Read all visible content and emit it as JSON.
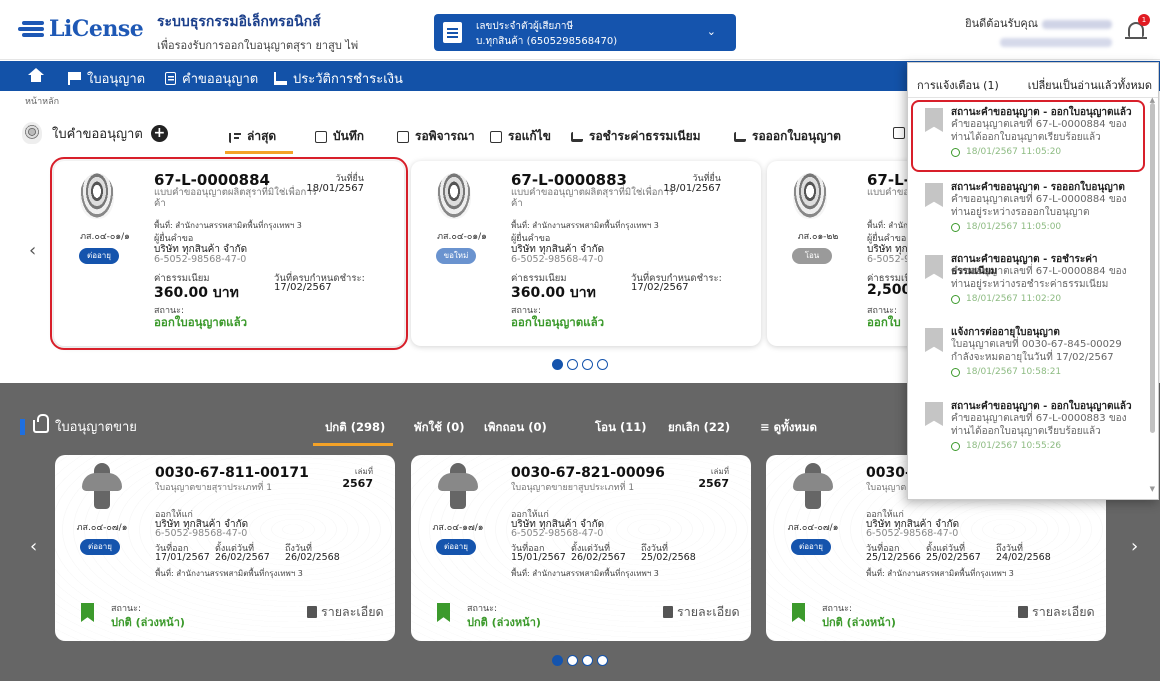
{
  "header": {
    "logo_text": "LiCense",
    "system_title": "ระบบธุรกรรมอิเล็กทรอนิกส์",
    "system_subtitle": "เพื่อรองรับการออกใบอนุญาตสุรา ยาสูบ ไพ่",
    "licensee_label": "เลขประจำตัวผู้เสียภาษี",
    "licensee_value": "บ.ทุกสินค้า (6505298568470)",
    "welcome_text": "ยินดีต้อนรับคุณ",
    "notification_count": "1"
  },
  "nav": {
    "items": [
      "ใบอนุญาต",
      "คำขออนุญาต",
      "ประวัติการชำระเงิน"
    ]
  },
  "breadcrumb": "หน้าหลัก",
  "applications": {
    "title": "ใบคำขออนุญาต",
    "tabs": [
      "ล่าสุด",
      "บันทึก",
      "รอพิจารณา",
      "รอแก้ไข",
      "รอชำระค่าธรรมเนียม",
      "รอออกใบอนุญาต"
    ],
    "cards": [
      {
        "code": "ภส.๐๔-๐๑/๑",
        "badge": "ต่ออายุ",
        "number": "67-L-0000884",
        "type": "แบบคำขออนุญาตผลิตสุราที่มิใช่เพื่อการค้า",
        "date_label": "วันที่ยื่น",
        "date_value": "18/01/2567",
        "area": "พื้นที่: สำนักงานสรรพสามิตพื้นที่กรุงเทพฯ 3",
        "applicant_label": "ผู้ยื่นคำขอ",
        "company": "บริษัท ทุกสินค้า จำกัด",
        "tax_id": "6-5052-98568-47-0",
        "fee_label": "ค่าธรรมเนียม",
        "fee_value": "360.00 บาท",
        "due_label": "วันที่ครบกำหนดชำระ:",
        "due_value": "17/02/2567",
        "status_label": "สถานะ:",
        "status_value": "ออกใบอนุญาตแล้ว"
      },
      {
        "code": "ภส.๐๔-๐๑/๑",
        "badge": "ขอใหม่",
        "number": "67-L-0000883",
        "type": "แบบคำขออนุญาตผลิตสุราที่มิใช่เพื่อการค้า",
        "date_label": "วันที่ยื่น",
        "date_value": "18/01/2567",
        "area": "พื้นที่: สำนักงานสรรพสามิตพื้นที่กรุงเทพฯ 3",
        "applicant_label": "ผู้ยื่นคำขอ",
        "company": "บริษัท ทุกสินค้า จำกัด",
        "tax_id": "6-5052-98568-47-0",
        "fee_label": "ค่าธรรมเนียม",
        "fee_value": "360.00 บาท",
        "due_label": "วันที่ครบกำหนดชำระ:",
        "due_value": "17/02/2567",
        "status_label": "สถานะ:",
        "status_value": "ออกใบอนุญาตแล้ว"
      },
      {
        "code": "ภส.๐๑-๒๒",
        "badge": "โอน",
        "number": "67-L-0",
        "type": "แบบคำขอ",
        "date_label": "",
        "date_value": "",
        "area": "พื้นที่: สำนัก",
        "applicant_label": "ผู้ยื่นคำขอ",
        "company": "บริษัท ทุกส",
        "tax_id": "6-5052-9",
        "fee_label": "ค่าธรรมเนี",
        "fee_value": "2,500.0",
        "due_label": "",
        "due_value": "",
        "status_label": "สถานะ:",
        "status_value": "ออกใบ"
      }
    ]
  },
  "licenses": {
    "title": "ใบอนุญาตขาย",
    "tabs": [
      "ปกติ (298)",
      "พักใช้ (0)",
      "เพิกถอน (0)",
      "โอน (11)",
      "ยกเลิก (22)",
      "ดูทั้งหมด"
    ],
    "cards": [
      {
        "code": "ภส.๐๔-๐๗/๑",
        "badge": "ต่ออายุ",
        "number": "0030-67-811-00171",
        "type": "ใบอนุญาตขายสุราประเภทที่ 1",
        "book_label": "เล่มที่",
        "book_value": "2567",
        "issued_to_label": "ออกให้แก่",
        "company": "บริษัท ทุกสินค้า จำกัด",
        "tax_id": "6-5052-98568-47-0",
        "issue_label": "วันที่ออก",
        "issue_value": "17/01/2567",
        "from_label": "ตั้งแต่วันที่",
        "from_value": "26/02/2567",
        "to_label": "ถึงวันที่",
        "to_value": "26/02/2568",
        "area": "พื้นที่: สำนักงานสรรพสามิตพื้นที่กรุงเทพฯ 3",
        "status_label": "สถานะ:",
        "status_value": "ปกติ (ล่วงหน้า)",
        "detail": "รายละเอียด"
      },
      {
        "code": "ภส.๐๔-๑๗/๑",
        "badge": "ต่ออายุ",
        "number": "0030-67-821-00096",
        "type": "ใบอนุญาตขายยาสูบประเภทที่ 1",
        "book_label": "เล่มที่",
        "book_value": "2567",
        "issued_to_label": "ออกให้แก่",
        "company": "บริษัท ทุกสินค้า จำกัด",
        "tax_id": "6-5052-98568-47-0",
        "issue_label": "วันที่ออก",
        "issue_value": "15/01/2567",
        "from_label": "ตั้งแต่วันที่",
        "from_value": "26/02/2567",
        "to_label": "ถึงวันที่",
        "to_value": "25/02/2568",
        "area": "พื้นที่: สำนักงานสรรพสามิตพื้นที่กรุงเทพฯ 3",
        "status_label": "สถานะ:",
        "status_value": "ปกติ (ล่วงหน้า)",
        "detail": "รายละเอียด"
      },
      {
        "code": "ภส.๐๔-๐๗/๑",
        "badge": "ต่ออายุ",
        "number": "0030-",
        "type": "ใบอนุญาต",
        "book_label": "",
        "book_value": "",
        "issued_to_label": "ออกให้แก่",
        "company": "บริษัท ทุกสินค้า จำกัด",
        "tax_id": "6-5052-98568-47-0",
        "issue_label": "วันที่ออก",
        "issue_value": "25/12/2566",
        "from_label": "ตั้งแต่วันที่",
        "from_value": "25/02/2567",
        "to_label": "ถึงวันที่",
        "to_value": "24/02/2568",
        "area": "พื้นที่: สำนักงานสรรพสามิตพื้นที่กรุงเทพฯ 3",
        "status_label": "สถานะ:",
        "status_value": "ปกติ (ล่วงหน้า)",
        "detail": "รายละเอียด"
      }
    ]
  },
  "notifications": {
    "header": "การแจ้งเตือน (1)",
    "mark_all": "เปลี่ยนเป็นอ่านแล้วทั้งหมด",
    "items": [
      {
        "title": "สถานะคำขออนุญาต - ออกใบอนุญาตแล้ว",
        "body": "คำขออนุญาตเลขที่ 67-L-0000884 ของท่านได้ออกใบอนุญาตเรียบร้อยแล้ว",
        "time": "18/01/2567 11:05:20"
      },
      {
        "title": "สถานะคำขออนุญาต - รอออกใบอนุญาต",
        "body": "คำขออนุญาตเลขที่ 67-L-0000884 ของท่านอยู่ระหว่างรอออกใบอนุญาต",
        "time": "18/01/2567 11:05:00"
      },
      {
        "title": "สถานะคำขออนุญาต - รอชำระค่าธรรมเนียม",
        "body": "คำขออนุญาตเลขที่ 67-L-0000884 ของท่านอยู่ระหว่างรอชำระค่าธรรมเนียม",
        "time": "18/01/2567 11:02:20"
      },
      {
        "title": "แจ้งการต่ออายุใบอนุญาต",
        "body": "ใบอนุญาตเลขที่ 0030-67-845-00029 กำลังจะหมดอายุในวันที่ 17/02/2567",
        "time": "18/01/2567 10:58:21"
      },
      {
        "title": "สถานะคำขออนุญาต - ออกใบอนุญาตแล้ว",
        "body": "คำขออนุญาตเลขที่ 67-L-0000883 ของท่านได้ออกใบอนุญาตเรียบร้อยแล้ว",
        "time": "18/01/2567 10:55:26"
      }
    ]
  },
  "colors": {
    "primary": "#1554ad",
    "accent": "#f4a227",
    "status_green": "#3c9a2c",
    "highlight_red": "#d81f2a"
  }
}
